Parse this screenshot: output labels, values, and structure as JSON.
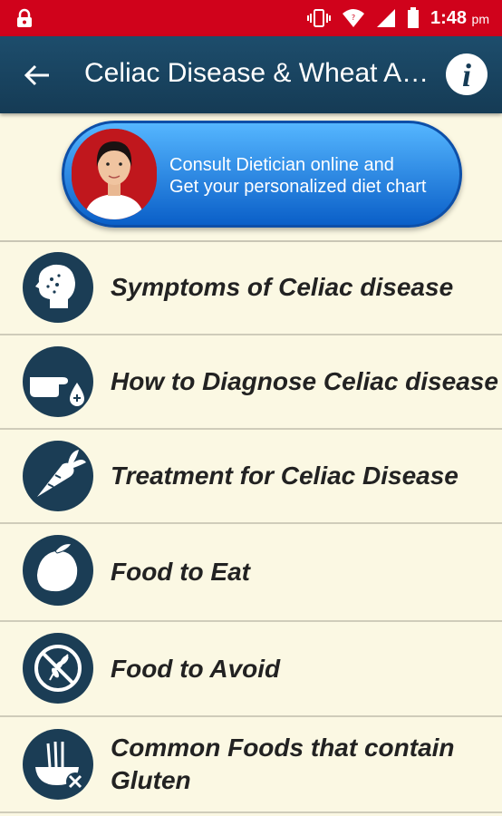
{
  "status_bar": {
    "time": "1:48",
    "ampm": "pm"
  },
  "app_bar": {
    "title": "Celiac Disease & Wheat Allergy"
  },
  "banner": {
    "line1": "Consult Dietician online and",
    "line2": "Get your personalized diet chart"
  },
  "items": [
    {
      "label": "Symptoms of Celiac disease"
    },
    {
      "label": "How to Diagnose Celiac disease"
    },
    {
      "label": "Treatment for Celiac Disease"
    },
    {
      "label": "Food to Eat"
    },
    {
      "label": "Food to Avoid"
    },
    {
      "label_line1": "Common Foods that contain",
      "label_line2": "Gluten"
    }
  ],
  "colors": {
    "status_bar": "#d0021b",
    "app_bar": "#153b55",
    "background": "#fbf8e3",
    "icon_circle": "#1b3d55"
  }
}
